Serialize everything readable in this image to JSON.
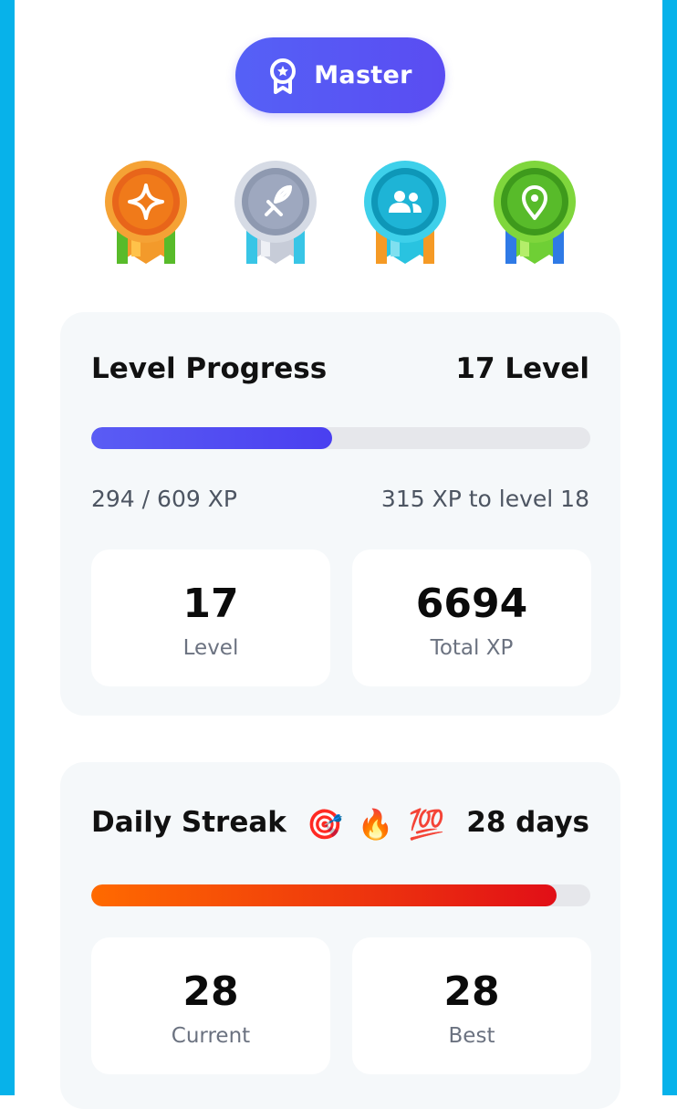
{
  "rank": {
    "label": "Master",
    "icon": "award-badge-icon"
  },
  "medals": [
    {
      "name": "orange-star-medal",
      "icon": "sparkle-icon",
      "color": "#f07a1a"
    },
    {
      "name": "silver-sword-medal",
      "icon": "sword-icon",
      "color": "#9ea8bf"
    },
    {
      "name": "cyan-group-medal",
      "icon": "users-icon",
      "color": "#1eb4d6"
    },
    {
      "name": "green-location-medal",
      "icon": "map-pin-icon",
      "color": "#58bb2a"
    }
  ],
  "level_progress": {
    "title": "Level Progress",
    "level_label": "17 Level",
    "progress_fraction": 0.483,
    "xp_text": "294 / 609 XP",
    "to_next_text": "315 XP to level 18",
    "stats": [
      {
        "value": "17",
        "caption": "Level"
      },
      {
        "value": "6694",
        "caption": "Total XP"
      }
    ]
  },
  "daily_streak": {
    "title": "Daily Streak",
    "emojis": [
      "🎯",
      "🔥",
      "💯"
    ],
    "days_label": "28 days",
    "progress_fraction": 0.933,
    "stats": [
      {
        "value": "28",
        "caption": "Current"
      },
      {
        "value": "28",
        "caption": "Best"
      }
    ]
  },
  "colors": {
    "frame": "#07b2ea",
    "accent": "#5a4cf2",
    "streak_start": "#ff6a00",
    "streak_end": "#e10f17"
  }
}
